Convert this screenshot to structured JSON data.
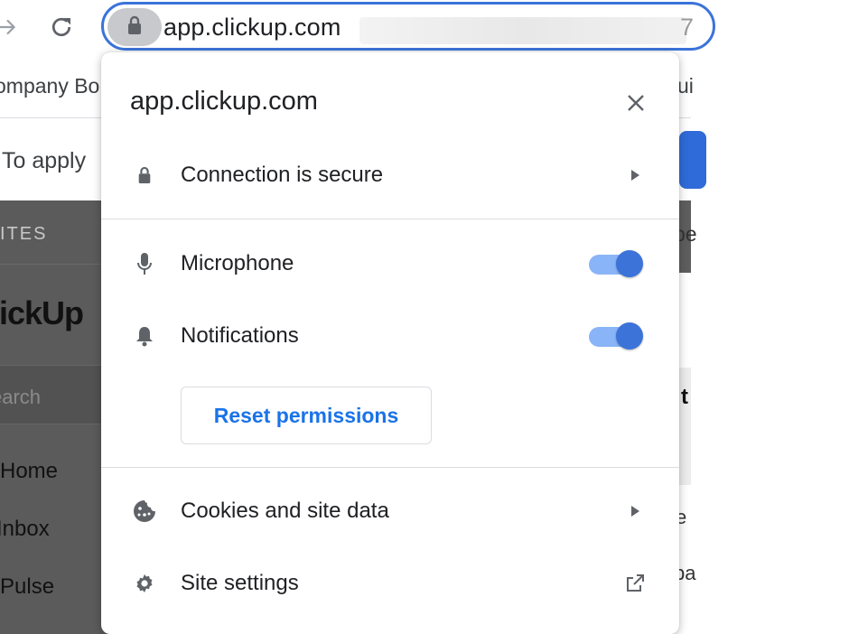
{
  "browser": {
    "address_bar": {
      "domain": "app.clickup.com",
      "trailing_char": "7"
    },
    "bookmarks_bar": {
      "left_text": "ompany Bo",
      "right_text": "ui"
    },
    "infobar": {
      "text": "To apply"
    }
  },
  "background_page": {
    "sidebar": {
      "section_header": "ITES",
      "logo": "lickUp",
      "search_placeholder": "earch",
      "items": [
        "Home",
        "Inbox",
        "Pulse"
      ]
    },
    "right_fragments": {
      "top": "pe",
      "bold": "t",
      "mid": "e",
      "bottom": "pa"
    }
  },
  "popup": {
    "title": "app.clickup.com",
    "connection_label": "Connection is secure",
    "permissions": [
      {
        "label": "Microphone",
        "enabled": true
      },
      {
        "label": "Notifications",
        "enabled": true
      }
    ],
    "reset_button": "Reset permissions",
    "cookies_label": "Cookies and site data",
    "site_settings_label": "Site settings",
    "accent_color": "#3b73d9"
  }
}
